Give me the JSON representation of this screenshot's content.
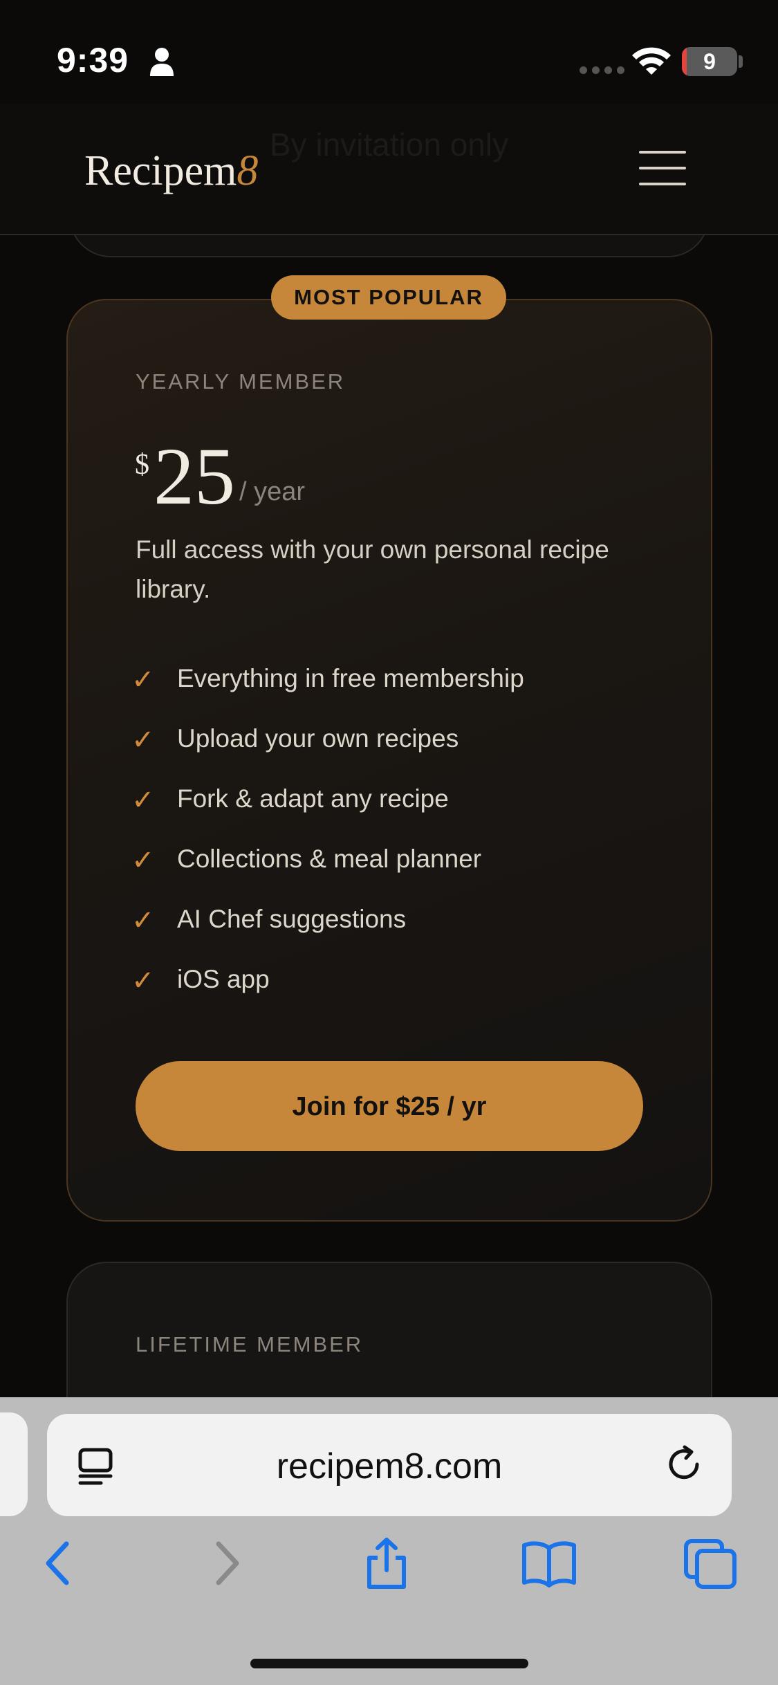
{
  "status_bar": {
    "time": "9:39",
    "battery_level": "9",
    "battery_fraction": 0.09
  },
  "header": {
    "ghost_text": "By invitation only",
    "logo_main": "Recipem",
    "logo_accent": "8"
  },
  "plan": {
    "badge": "MOST POPULAR",
    "label": "YEARLY MEMBER",
    "currency": "$",
    "amount": "25",
    "period": "/ year",
    "description": "Full access with your own personal recipe library.",
    "check_glyph": "✓",
    "features": [
      "Everything in free membership",
      "Upload your own recipes",
      "Fork & adapt any recipe",
      "Collections & meal planner",
      "AI Chef suggestions",
      "iOS app"
    ],
    "cta_label": "Join for $25 / yr"
  },
  "next_plan": {
    "label": "LIFETIME MEMBER"
  },
  "browser": {
    "url": "recipem8.com"
  },
  "colors": {
    "accent": "#c6873a",
    "background": "#0b0a09",
    "ios_blue": "#1a73e8"
  }
}
